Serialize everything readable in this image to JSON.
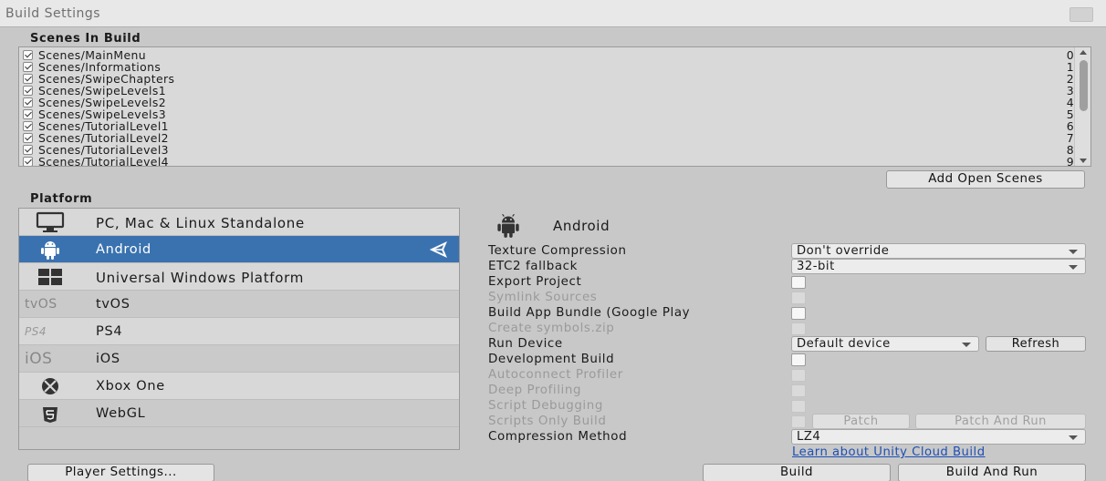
{
  "window": {
    "title": "Build Settings"
  },
  "scenes_section": {
    "label": "Scenes In Build"
  },
  "scenes": [
    {
      "name": "Scenes/MainMenu",
      "index": "0"
    },
    {
      "name": "Scenes/Informations",
      "index": "1"
    },
    {
      "name": "Scenes/SwipeChapters",
      "index": "2"
    },
    {
      "name": "Scenes/SwipeLevels1",
      "index": "3"
    },
    {
      "name": "Scenes/SwipeLevels2",
      "index": "4"
    },
    {
      "name": "Scenes/SwipeLevels3",
      "index": "5"
    },
    {
      "name": "Scenes/TutorialLevel1",
      "index": "6"
    },
    {
      "name": "Scenes/TutorialLevel2",
      "index": "7"
    },
    {
      "name": "Scenes/TutorialLevel3",
      "index": "8"
    },
    {
      "name": "Scenes/TutorialLevel4",
      "index": "9"
    }
  ],
  "add_open_scenes_label": "Add Open Scenes",
  "platform_section": {
    "label": "Platform"
  },
  "platforms": [
    {
      "label": "PC, Mac & Linux Standalone",
      "icon": "monitor-icon"
    },
    {
      "label": "Android",
      "icon": "android-icon",
      "selected": true
    },
    {
      "label": "Universal Windows Platform",
      "icon": "windows-icon"
    },
    {
      "label": "tvOS",
      "icon": "tvos-icon",
      "icon_text": "tvOS"
    },
    {
      "label": "PS4",
      "icon": "ps4-icon",
      "icon_text": "PS4"
    },
    {
      "label": "iOS",
      "icon": "ios-icon",
      "icon_text": "iOS"
    },
    {
      "label": "Xbox One",
      "icon": "xbox-icon"
    },
    {
      "label": "WebGL",
      "icon": "html5-icon",
      "icon_text": "HTML"
    }
  ],
  "selected_platform": {
    "label": "Android"
  },
  "options": {
    "texture_compression": {
      "label": "Texture Compression",
      "value": "Don't override"
    },
    "etc2_fallback": {
      "label": "ETC2 fallback",
      "value": "32-bit"
    },
    "export_project": {
      "label": "Export Project"
    },
    "symlink_sources": {
      "label": "Symlink Sources"
    },
    "build_app_bundle": {
      "label": "Build App Bundle (Google Play"
    },
    "create_symbols": {
      "label": "Create symbols.zip"
    },
    "run_device": {
      "label": "Run Device",
      "value": "Default device",
      "refresh_label": "Refresh"
    },
    "development_build": {
      "label": "Development Build"
    },
    "autoconnect_profiler": {
      "label": "Autoconnect Profiler"
    },
    "deep_profiling": {
      "label": "Deep Profiling"
    },
    "script_debugging": {
      "label": "Script Debugging"
    },
    "scripts_only_build": {
      "label": "Scripts Only Build",
      "patch_label": "Patch",
      "patch_and_run_label": "Patch And Run"
    },
    "compression_method": {
      "label": "Compression Method",
      "value": "LZ4"
    }
  },
  "cloud_build_link": "Learn about Unity Cloud Build",
  "player_settings_label": "Player Settings...",
  "build_label": "Build",
  "build_and_run_label": "Build And Run",
  "colors": {
    "selection": "#3a72b0",
    "link": "#1d4fb5",
    "background": "#c8c8c8"
  }
}
